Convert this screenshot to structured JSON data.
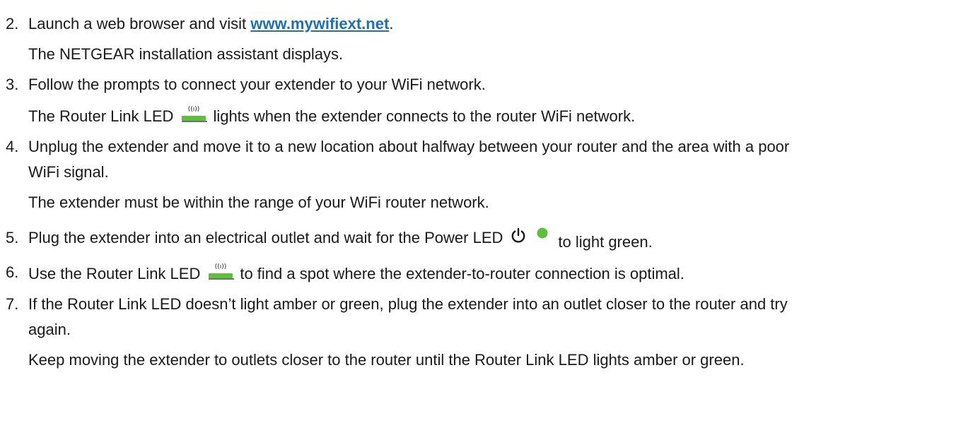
{
  "steps": [
    {
      "number": "2.",
      "pre": "Launch a web browser and visit ",
      "link": "www.mywifiext.net",
      "post": ".",
      "note": "The NETGEAR installation assistant displays."
    },
    {
      "number": "3.",
      "text": "Follow the prompts to connect your extender to your WiFi network.",
      "note_pre": "The Router Link LED",
      "note_post": "lights when the extender connects to the router WiFi network."
    },
    {
      "number": "4.",
      "line1": "Unplug the extender and move it to a new location about halfway between your router and the area with a poor",
      "line2": "WiFi signal.",
      "note": "The extender must be within the range of your WiFi router network."
    },
    {
      "number": "5.",
      "pre": "Plug the extender into an electrical outlet and wait for the Power LED",
      "post": "to light green."
    },
    {
      "number": "6.",
      "pre": "Use the Router Link LED",
      "post": "to find a spot where the extender-to-router connection is optimal."
    },
    {
      "number": "7.",
      "line1": "If the Router Link LED doesn’t light amber or green, plug the extender into an outlet closer to the router and try",
      "line2": "again.",
      "note": "Keep moving the extender to outlets closer to the router until the Router Link LED lights amber or green."
    }
  ],
  "colors": {
    "link": "#1f6fb5",
    "led_green": "#5cc13a",
    "text": "#1a1a1a"
  },
  "icons": {
    "router_link": "router-link-led-icon",
    "power": "power-icon",
    "led_dot": "green-led-dot-icon"
  }
}
